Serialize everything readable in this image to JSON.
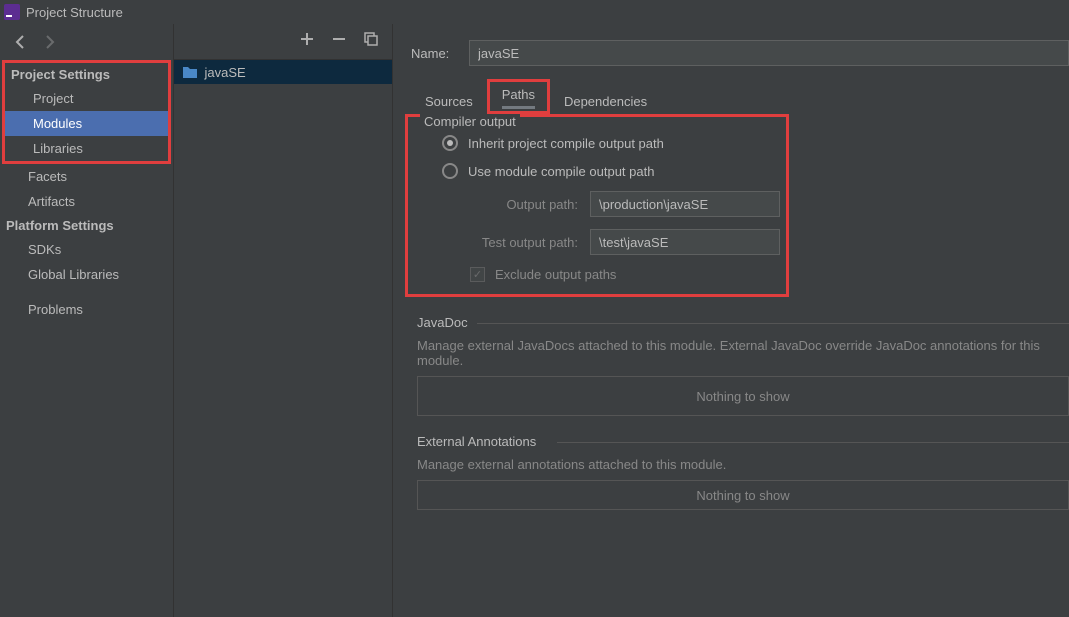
{
  "title": "Project Structure",
  "sidebar": {
    "sections": [
      {
        "label": "Project Settings",
        "items": [
          "Project",
          "Modules",
          "Libraries"
        ]
      },
      {
        "label": "",
        "items": [
          "Facets",
          "Artifacts"
        ]
      },
      {
        "label": "Platform Settings",
        "items": [
          "SDKs",
          "Global Libraries"
        ]
      },
      {
        "label": "",
        "items": [
          "Problems"
        ]
      }
    ],
    "selected": "Modules"
  },
  "middle": {
    "module_name": "javaSE"
  },
  "right": {
    "name_label": "Name:",
    "name_value": "javaSE",
    "tabs": [
      "Sources",
      "Paths",
      "Dependencies"
    ],
    "active_tab": "Paths",
    "compiler": {
      "title": "Compiler output",
      "radio_inherit": "Inherit project compile output path",
      "radio_module": "Use module compile output path",
      "output_label": "Output path:",
      "output_value": "\\production\\javaSE",
      "test_label": "Test output path:",
      "test_value": "\\test\\javaSE",
      "exclude_label": "Exclude output paths"
    },
    "javadoc": {
      "title": "JavaDoc",
      "desc": "Manage external JavaDocs attached to this module. External JavaDoc override JavaDoc annotations for this module.",
      "empty": "Nothing to show"
    },
    "ext": {
      "title": "External Annotations",
      "desc": "Manage external annotations attached to this module.",
      "empty": "Nothing to show"
    }
  }
}
